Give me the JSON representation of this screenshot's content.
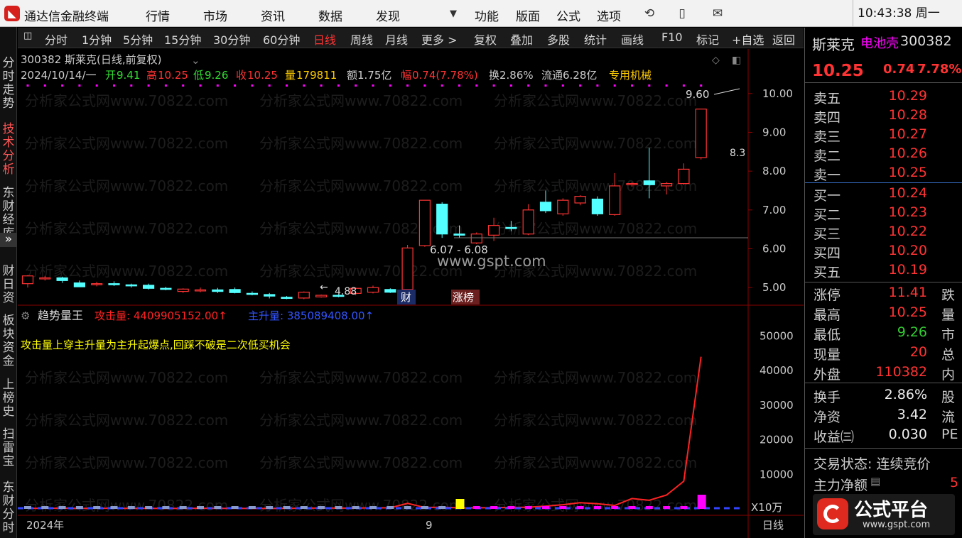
{
  "titlebar": {
    "app_name": "通达信金融终端",
    "menus": [
      "行情",
      "市场",
      "资讯",
      "数据",
      "发现"
    ],
    "right_menus": [
      "功能",
      "版面",
      "公式",
      "选项"
    ],
    "clock": "10:43:38 周一"
  },
  "leftnav": {
    "items": [
      "分时走势",
      "技术分析",
      "东财经库",
      "财日资",
      "板块资金",
      "上榜史",
      "扫雷宝",
      "东财分时"
    ]
  },
  "toolbar": {
    "items": [
      "分时",
      "1分钟",
      "5分钟",
      "15分钟",
      "30分钟",
      "60分钟",
      "日线",
      "周线",
      "月线",
      "更多 >",
      "复权",
      "叠加",
      "多股",
      "统计",
      "画线",
      "F10",
      "标记",
      "+自选",
      "返回"
    ],
    "active": "日线"
  },
  "stock": {
    "code": "300382",
    "name": "斯莱克",
    "concept": "电池壳",
    "price": "10.25",
    "change": "0.74",
    "pct": "7.78%"
  },
  "chart_header": {
    "title": "300382 斯莱克(日线,前复权)",
    "date": "2024/10/14/一",
    "open_label": "开",
    "open": "9.41",
    "high_label": "高",
    "high": "10.25",
    "low_label": "低",
    "low": "9.26",
    "close_label": "收",
    "close": "10.25",
    "vol_label": "量",
    "vol": "179811",
    "amt": "额1.75亿",
    "amp_label": "幅",
    "amp": "0.74(7.78%)",
    "turnover": "换2.86%",
    "float": "流通6.28亿",
    "industry": "专用机械"
  },
  "price_axis": [
    "10.00",
    "9.00",
    "8.00",
    "7.00",
    "6.00",
    "5.00"
  ],
  "annotations": {
    "high_mark": "9.60",
    "low_mark": "8.3",
    "range": "6.07 - 6.08",
    "bottom_low": "4.88",
    "tag_fin": "财",
    "tag_list": "涨榜",
    "watermark_center": "www.gspt.com",
    "watermark": "分析家公式网www.70822.com"
  },
  "indicator": {
    "name": "趋势量王",
    "attack_label": "攻击量: 4409905152.00↑",
    "main_label": "主升量: 385089408.00↑",
    "note": "攻击量上穿主升量为主升起爆点,回踩不破是二次低买机会",
    "axis": [
      "50000",
      "40000",
      "30000",
      "20000",
      "10000"
    ],
    "unit": "X10万"
  },
  "xaxis": {
    "labels": [
      "2024年",
      "9"
    ],
    "period": "日线"
  },
  "orderbook": {
    "sells": [
      {
        "label": "卖五",
        "price": "10.29"
      },
      {
        "label": "卖四",
        "price": "10.28"
      },
      {
        "label": "卖三",
        "price": "10.27"
      },
      {
        "label": "卖二",
        "price": "10.26"
      },
      {
        "label": "卖一",
        "price": "10.25"
      }
    ],
    "buys": [
      {
        "label": "买一",
        "price": "10.24"
      },
      {
        "label": "买二",
        "price": "10.23"
      },
      {
        "label": "买三",
        "price": "10.22"
      },
      {
        "label": "买四",
        "price": "10.20"
      },
      {
        "label": "买五",
        "price": "10.19"
      }
    ]
  },
  "quote": [
    {
      "label": "涨停",
      "value": "11.41",
      "side": "跌"
    },
    {
      "label": "最高",
      "value": "10.25",
      "side": "量"
    },
    {
      "label": "最低",
      "value": "9.26",
      "side": "市"
    },
    {
      "label": "现量",
      "value": "20",
      "side": "总"
    },
    {
      "label": "外盘",
      "value": "110382",
      "side": "内"
    }
  ],
  "stats": [
    {
      "label": "换手",
      "value": "2.86%",
      "side": "股"
    },
    {
      "label": "净资",
      "value": "3.42",
      "side": "流"
    },
    {
      "label": "收益㈢",
      "value": "0.030",
      "side": "PE"
    }
  ],
  "trade_status": "交易状态: 连续竞价",
  "main_net": "主力净额",
  "main_net_value": "5",
  "brand": {
    "name": "公式平台",
    "url": "www.gspt.com"
  },
  "colors": {
    "up": "#ff3333",
    "down": "#54ffff",
    "bg": "#000000",
    "attack": "#ff2222",
    "main": "#3344ff",
    "accent": "#ff00ff"
  },
  "chart_data": {
    "type": "candlestick",
    "title": "300382 斯莱克(日线,前复权)",
    "ylim": [
      4.6,
      10.6
    ],
    "candles": [
      {
        "o": 5.1,
        "h": 5.32,
        "l": 5.0,
        "c": 5.3
      },
      {
        "o": 5.23,
        "h": 5.3,
        "l": 5.18,
        "c": 5.25
      },
      {
        "o": 5.25,
        "h": 5.28,
        "l": 5.12,
        "c": 5.18
      },
      {
        "o": 5.12,
        "h": 5.18,
        "l": 5.08,
        "c": 5.02
      },
      {
        "o": 5.08,
        "h": 5.15,
        "l": 5.03,
        "c": 5.1
      },
      {
        "o": 5.1,
        "h": 5.16,
        "l": 5.04,
        "c": 5.08
      },
      {
        "o": 5.07,
        "h": 5.1,
        "l": 5.0,
        "c": 5.05
      },
      {
        "o": 5.06,
        "h": 5.1,
        "l": 4.95,
        "c": 4.98
      },
      {
        "o": 4.98,
        "h": 5.02,
        "l": 4.93,
        "c": 4.96
      },
      {
        "o": 4.9,
        "h": 4.98,
        "l": 4.86,
        "c": 4.96
      },
      {
        "o": 4.92,
        "h": 5.0,
        "l": 4.88,
        "c": 4.94
      },
      {
        "o": 4.94,
        "h": 4.99,
        "l": 4.86,
        "c": 4.9
      },
      {
        "o": 4.95,
        "h": 5.0,
        "l": 4.85,
        "c": 4.87
      },
      {
        "o": 4.85,
        "h": 4.9,
        "l": 4.8,
        "c": 4.83
      },
      {
        "o": 4.82,
        "h": 4.86,
        "l": 4.72,
        "c": 4.78
      },
      {
        "o": 4.75,
        "h": 4.78,
        "l": 4.7,
        "c": 4.72
      },
      {
        "o": 4.73,
        "h": 4.9,
        "l": 4.7,
        "c": 4.88
      },
      {
        "o": 4.76,
        "h": 4.82,
        "l": 4.74,
        "c": 4.8
      },
      {
        "o": 4.8,
        "h": 4.82,
        "l": 4.75,
        "c": 4.78
      },
      {
        "o": 4.85,
        "h": 5.0,
        "l": 4.8,
        "c": 4.98
      },
      {
        "o": 4.88,
        "h": 5.05,
        "l": 4.85,
        "c": 5.0
      },
      {
        "o": 4.95,
        "h": 4.98,
        "l": 4.86,
        "c": 4.88
      },
      {
        "o": 4.95,
        "h": 6.1,
        "l": 4.92,
        "c": 6.02
      },
      {
        "o": 6.08,
        "h": 7.25,
        "l": 6.05,
        "c": 7.25
      },
      {
        "o": 7.15,
        "h": 7.2,
        "l": 6.28,
        "c": 6.38
      },
      {
        "o": 6.38,
        "h": 6.6,
        "l": 6.28,
        "c": 6.35
      },
      {
        "o": 6.15,
        "h": 6.42,
        "l": 6.12,
        "c": 6.38
      },
      {
        "o": 6.35,
        "h": 6.8,
        "l": 6.2,
        "c": 6.6
      },
      {
        "o": 6.55,
        "h": 6.72,
        "l": 6.45,
        "c": 6.52
      },
      {
        "o": 6.38,
        "h": 7.15,
        "l": 6.35,
        "c": 7.0
      },
      {
        "o": 7.2,
        "h": 7.5,
        "l": 6.92,
        "c": 6.98
      },
      {
        "o": 6.9,
        "h": 7.3,
        "l": 6.85,
        "c": 7.25
      },
      {
        "o": 7.18,
        "h": 7.38,
        "l": 7.12,
        "c": 7.35
      },
      {
        "o": 7.28,
        "h": 7.35,
        "l": 6.85,
        "c": 6.9
      },
      {
        "o": 6.88,
        "h": 7.95,
        "l": 6.85,
        "c": 7.62
      },
      {
        "o": 7.65,
        "h": 7.72,
        "l": 7.6,
        "c": 7.68
      },
      {
        "o": 7.75,
        "h": 8.6,
        "l": 7.3,
        "c": 7.65
      },
      {
        "o": 7.62,
        "h": 7.72,
        "l": 7.4,
        "c": 7.68
      },
      {
        "o": 7.68,
        "h": 8.2,
        "l": 7.65,
        "c": 8.05
      },
      {
        "o": 8.35,
        "h": 9.6,
        "l": 8.3,
        "c": 9.6
      }
    ]
  },
  "indicator_data": {
    "attack": [
      150,
      180,
      200,
      160,
      170,
      190,
      150,
      160,
      140,
      150,
      170,
      160,
      150,
      140,
      130,
      150,
      200,
      250,
      220,
      230,
      300,
      320,
      1600,
      400,
      500,
      300,
      300,
      350,
      400,
      500,
      800,
      1200,
      1800,
      1500,
      1000,
      3000,
      2500,
      4000,
      8000,
      44000
    ]
  }
}
